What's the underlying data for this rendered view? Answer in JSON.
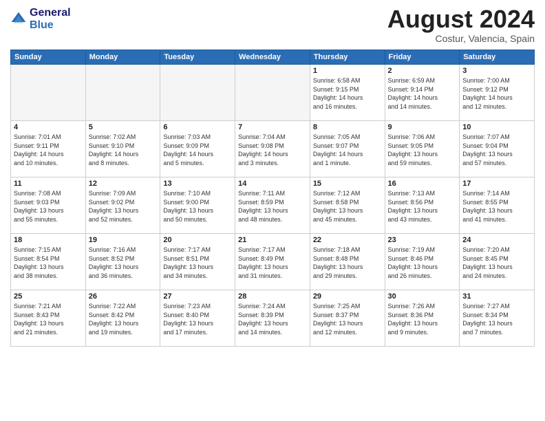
{
  "logo": {
    "line1": "General",
    "line2": "Blue"
  },
  "title": "August 2024",
  "subtitle": "Costur, Valencia, Spain",
  "days_of_week": [
    "Sunday",
    "Monday",
    "Tuesday",
    "Wednesday",
    "Thursday",
    "Friday",
    "Saturday"
  ],
  "weeks": [
    [
      {
        "day": "",
        "info": ""
      },
      {
        "day": "",
        "info": ""
      },
      {
        "day": "",
        "info": ""
      },
      {
        "day": "",
        "info": ""
      },
      {
        "day": "1",
        "info": "Sunrise: 6:58 AM\nSunset: 9:15 PM\nDaylight: 14 hours\nand 16 minutes."
      },
      {
        "day": "2",
        "info": "Sunrise: 6:59 AM\nSunset: 9:14 PM\nDaylight: 14 hours\nand 14 minutes."
      },
      {
        "day": "3",
        "info": "Sunrise: 7:00 AM\nSunset: 9:12 PM\nDaylight: 14 hours\nand 12 minutes."
      }
    ],
    [
      {
        "day": "4",
        "info": "Sunrise: 7:01 AM\nSunset: 9:11 PM\nDaylight: 14 hours\nand 10 minutes."
      },
      {
        "day": "5",
        "info": "Sunrise: 7:02 AM\nSunset: 9:10 PM\nDaylight: 14 hours\nand 8 minutes."
      },
      {
        "day": "6",
        "info": "Sunrise: 7:03 AM\nSunset: 9:09 PM\nDaylight: 14 hours\nand 5 minutes."
      },
      {
        "day": "7",
        "info": "Sunrise: 7:04 AM\nSunset: 9:08 PM\nDaylight: 14 hours\nand 3 minutes."
      },
      {
        "day": "8",
        "info": "Sunrise: 7:05 AM\nSunset: 9:07 PM\nDaylight: 14 hours\nand 1 minute."
      },
      {
        "day": "9",
        "info": "Sunrise: 7:06 AM\nSunset: 9:05 PM\nDaylight: 13 hours\nand 59 minutes."
      },
      {
        "day": "10",
        "info": "Sunrise: 7:07 AM\nSunset: 9:04 PM\nDaylight: 13 hours\nand 57 minutes."
      }
    ],
    [
      {
        "day": "11",
        "info": "Sunrise: 7:08 AM\nSunset: 9:03 PM\nDaylight: 13 hours\nand 55 minutes."
      },
      {
        "day": "12",
        "info": "Sunrise: 7:09 AM\nSunset: 9:02 PM\nDaylight: 13 hours\nand 52 minutes."
      },
      {
        "day": "13",
        "info": "Sunrise: 7:10 AM\nSunset: 9:00 PM\nDaylight: 13 hours\nand 50 minutes."
      },
      {
        "day": "14",
        "info": "Sunrise: 7:11 AM\nSunset: 8:59 PM\nDaylight: 13 hours\nand 48 minutes."
      },
      {
        "day": "15",
        "info": "Sunrise: 7:12 AM\nSunset: 8:58 PM\nDaylight: 13 hours\nand 45 minutes."
      },
      {
        "day": "16",
        "info": "Sunrise: 7:13 AM\nSunset: 8:56 PM\nDaylight: 13 hours\nand 43 minutes."
      },
      {
        "day": "17",
        "info": "Sunrise: 7:14 AM\nSunset: 8:55 PM\nDaylight: 13 hours\nand 41 minutes."
      }
    ],
    [
      {
        "day": "18",
        "info": "Sunrise: 7:15 AM\nSunset: 8:54 PM\nDaylight: 13 hours\nand 38 minutes."
      },
      {
        "day": "19",
        "info": "Sunrise: 7:16 AM\nSunset: 8:52 PM\nDaylight: 13 hours\nand 36 minutes."
      },
      {
        "day": "20",
        "info": "Sunrise: 7:17 AM\nSunset: 8:51 PM\nDaylight: 13 hours\nand 34 minutes."
      },
      {
        "day": "21",
        "info": "Sunrise: 7:17 AM\nSunset: 8:49 PM\nDaylight: 13 hours\nand 31 minutes."
      },
      {
        "day": "22",
        "info": "Sunrise: 7:18 AM\nSunset: 8:48 PM\nDaylight: 13 hours\nand 29 minutes."
      },
      {
        "day": "23",
        "info": "Sunrise: 7:19 AM\nSunset: 8:46 PM\nDaylight: 13 hours\nand 26 minutes."
      },
      {
        "day": "24",
        "info": "Sunrise: 7:20 AM\nSunset: 8:45 PM\nDaylight: 13 hours\nand 24 minutes."
      }
    ],
    [
      {
        "day": "25",
        "info": "Sunrise: 7:21 AM\nSunset: 8:43 PM\nDaylight: 13 hours\nand 21 minutes."
      },
      {
        "day": "26",
        "info": "Sunrise: 7:22 AM\nSunset: 8:42 PM\nDaylight: 13 hours\nand 19 minutes."
      },
      {
        "day": "27",
        "info": "Sunrise: 7:23 AM\nSunset: 8:40 PM\nDaylight: 13 hours\nand 17 minutes."
      },
      {
        "day": "28",
        "info": "Sunrise: 7:24 AM\nSunset: 8:39 PM\nDaylight: 13 hours\nand 14 minutes."
      },
      {
        "day": "29",
        "info": "Sunrise: 7:25 AM\nSunset: 8:37 PM\nDaylight: 13 hours\nand 12 minutes."
      },
      {
        "day": "30",
        "info": "Sunrise: 7:26 AM\nSunset: 8:36 PM\nDaylight: 13 hours\nand 9 minutes."
      },
      {
        "day": "31",
        "info": "Sunrise: 7:27 AM\nSunset: 8:34 PM\nDaylight: 13 hours\nand 7 minutes."
      }
    ]
  ]
}
